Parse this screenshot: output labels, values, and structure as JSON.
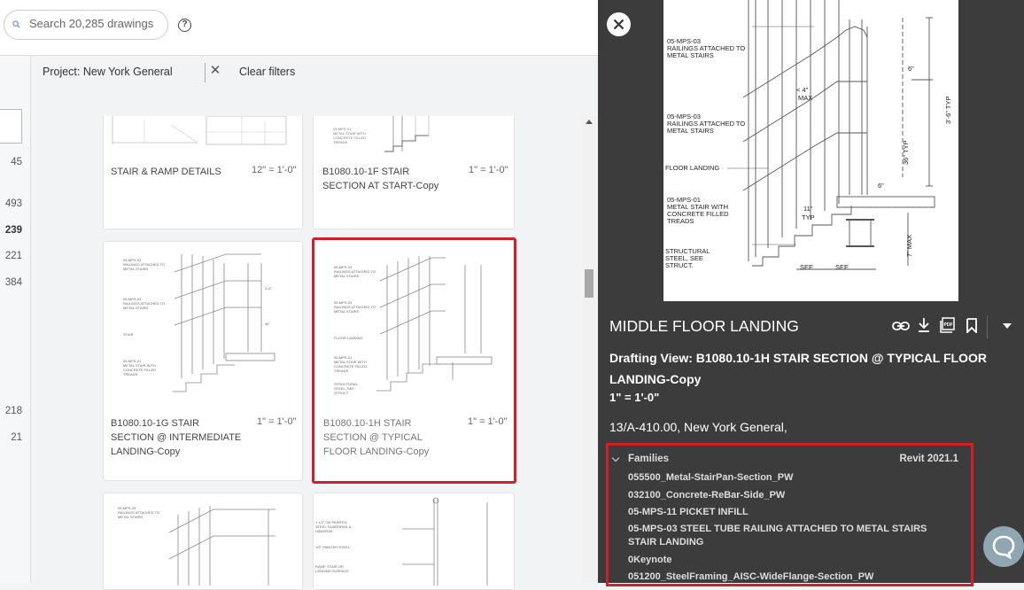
{
  "search": {
    "placeholder": "Search 20,285 drawings"
  },
  "help_icon": "question-circle-icon",
  "filters": {
    "chip_label": "Project: New York General",
    "remove_icon": "x-icon",
    "clear_label": "Clear filters"
  },
  "left_counts": [
    "45",
    "493",
    "239",
    "221",
    "384",
    "218",
    "21"
  ],
  "cards": [
    {
      "title": "STAIR & RAMP DETAILS",
      "scale": "12\" = 1'-0\""
    },
    {
      "title": "B1080.10-1F STAIR SECTION AT START-Copy",
      "scale": "1\" = 1'-0\""
    },
    {
      "title": "B1080.10-1G STAIR SECTION @ INTERMEDIATE LANDING-Copy",
      "scale": "1\" = 1'-0\""
    },
    {
      "title": "B1080.10-1H STAIR SECTION @ TYPICAL FLOOR LANDING-Copy",
      "scale": "1\" = 1'-0\""
    }
  ],
  "preview": {
    "notes": [
      "05-MPS-03",
      "RAILINGS ATTACHED TO",
      "METAL STAIRS",
      "05-MPS-03",
      "RAILINGS ATTACHED TO",
      "METAL STAIRS",
      "FLOOR LANDING",
      "05-MPS-01",
      "METAL STAIR WITH",
      "CONCRETE FILLED",
      "TREADS",
      "STRUCTURAL",
      "STEEL, SEE",
      "STRUCT."
    ],
    "dims": [
      "6\"",
      "< 4\"",
      "MAX",
      "3'-6\" TYP",
      "36\" TYP",
      "6\"",
      "11\"",
      "TYP",
      "7\" MAX",
      "SEE",
      "SEE"
    ]
  },
  "detail": {
    "title": "MIDDLE FLOOR LANDING",
    "tools": [
      "link-icon",
      "download-icon",
      "pdf-icon",
      "bookmark-icon",
      "chevron-down-icon"
    ],
    "description": "Drafting View: B1080.10-1H STAIR SECTION @ TYPICAL FLOOR LANDING-Copy",
    "scale": "1\" = 1'-0\"",
    "location": "13/A-410.00, New York General,",
    "families_label": "Families",
    "revit_version": "Revit 2021.1",
    "families": [
      "055500_Metal-StairPan-Section_PW",
      "032100_Concrete-ReBar-Side_PW",
      "05-MPS-11 PICKET INFILL",
      "05-MPS-03 STEEL TUBE RAILING ATTACHED TO METAL STAIRS STAIR LANDING",
      "0Keynote",
      "051200_SteelFraming_AISC-WideFlange-Section_PW"
    ]
  },
  "colors": {
    "selection": "#d0202a",
    "panel_bg": "#3c3c3c",
    "page_bg": "#f1f3f4"
  }
}
